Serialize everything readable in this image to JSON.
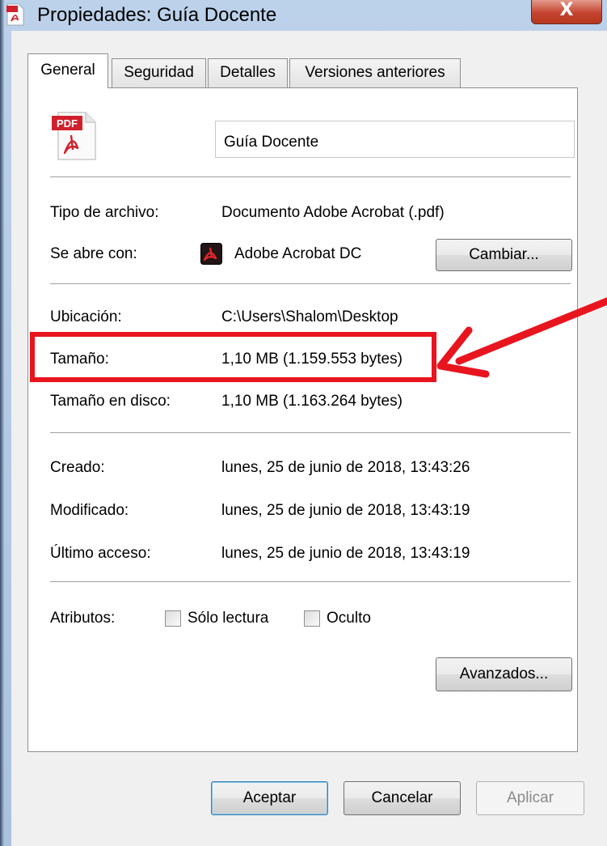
{
  "window": {
    "title": "Propiedades: Guía Docente",
    "close_glyph": "X"
  },
  "tabs": [
    {
      "label": "General",
      "active": true
    },
    {
      "label": "Seguridad",
      "active": false
    },
    {
      "label": "Detalles",
      "active": false
    },
    {
      "label": "Versiones anteriores",
      "active": false
    }
  ],
  "file": {
    "name": "Guía Docente",
    "icon": "pdf-file-icon",
    "icon_badge": "PDF"
  },
  "info": {
    "type_label": "Tipo de archivo:",
    "type_value": "Documento Adobe Acrobat (.pdf)",
    "opens_label": "Se abre con:",
    "opens_value": "Adobe Acrobat DC",
    "opens_icon": "acrobat-icon",
    "change_button": "Cambiar...",
    "location_label": "Ubicación:",
    "location_value": "C:\\Users\\Shalom\\Desktop",
    "size_label": "Tamaño:",
    "size_value": "1,10 MB (1.159.553 bytes)",
    "disk_size_label": "Tamaño en disco:",
    "disk_size_value": "1,10 MB (1.163.264 bytes)",
    "created_label": "Creado:",
    "created_value": "lunes, 25 de junio de 2018, 13:43:26",
    "modified_label": "Modificado:",
    "modified_value": "lunes, 25 de junio de 2018, 13:43:19",
    "accessed_label": "Último acceso:",
    "accessed_value": "lunes, 25 de junio de 2018, 13:43:19"
  },
  "attributes": {
    "label": "Atributos:",
    "readonly_label": "Sólo lectura",
    "readonly_checked": false,
    "hidden_label": "Oculto",
    "hidden_checked": false,
    "advanced_button": "Avanzados..."
  },
  "footer": {
    "ok": "Aceptar",
    "cancel": "Cancelar",
    "apply": "Aplicar"
  },
  "annotation": {
    "highlight_color": "#e8141e"
  }
}
